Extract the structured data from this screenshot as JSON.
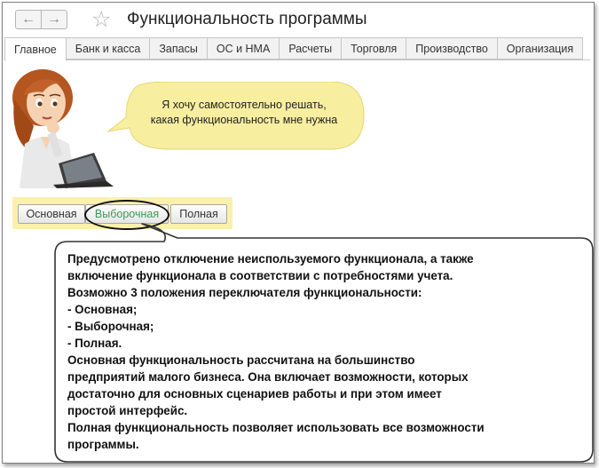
{
  "window": {
    "title": "Функциональность программы",
    "nav": {
      "back_glyph": "←",
      "forward_glyph": "→",
      "star_glyph": "☆"
    }
  },
  "tabs": [
    {
      "label": "Главное",
      "active": true
    },
    {
      "label": "Банк и касса",
      "active": false
    },
    {
      "label": "Запасы",
      "active": false
    },
    {
      "label": "ОС и НМА",
      "active": false
    },
    {
      "label": "Расчеты",
      "active": false
    },
    {
      "label": "Торговля",
      "active": false
    },
    {
      "label": "Производство",
      "active": false
    },
    {
      "label": "Организация",
      "active": false
    }
  ],
  "bubble": {
    "line1": "Я хочу самостоятельно решать,",
    "line2": "какая функциональность мне нужна"
  },
  "switch": {
    "options": [
      "Основная",
      "Выборочная",
      "Полная"
    ],
    "selected": "Выборочная"
  },
  "info": {
    "lines": [
      "Предусмотрено отключение неиспользуемого функционала, а также",
      "включение функционала в соответствии с потребностями учета.",
      "Возможно 3 положения переключателя функциональности:",
      "- Основная;",
      "- Выборочная;",
      "- Полная.",
      "Основная функциональность рассчитана на большинство",
      "предприятий малого бизнеса. Она включает возможности, которых",
      "достаточно для основных сценариев работы и при этом имеет",
      "простой интерфейс.",
      "Полная функциональность позволяет использовать все возможности",
      "программы."
    ]
  },
  "colors": {
    "bubble_fill": "#f8eea0",
    "switch_panel": "#fbf0ad",
    "selected_text": "#3a9a57",
    "callout_fill": "#ffffff",
    "callout_border": "#333333"
  }
}
